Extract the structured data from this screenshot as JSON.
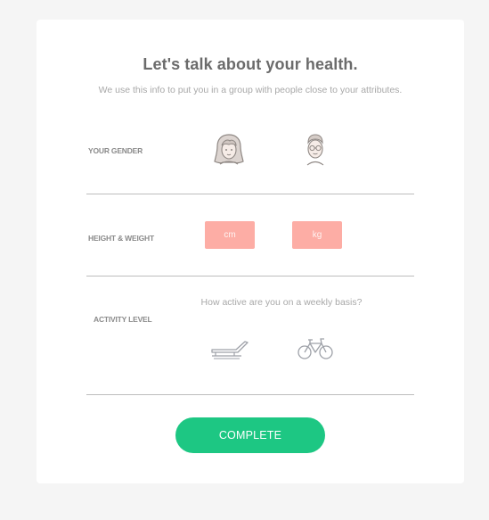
{
  "header": {
    "title": "Let's talk about your health.",
    "subtitle": "We use this info to put you in a group with people close to your attributes."
  },
  "gender": {
    "label": "YOUR GENDER",
    "options": [
      {
        "icon": "female-avatar-icon"
      },
      {
        "icon": "male-avatar-icon"
      }
    ]
  },
  "body_metrics": {
    "label": "HEIGHT & WEIGHT",
    "height_placeholder": "cm",
    "weight_placeholder": "kg",
    "height_value": "",
    "weight_value": ""
  },
  "activity": {
    "label": "ACTIVITY LEVEL",
    "question": "How active are you on a weekly basis?",
    "options": [
      {
        "icon": "lounge-chair-icon"
      },
      {
        "icon": "bicycle-icon"
      }
    ]
  },
  "actions": {
    "complete_label": "COMPLETE"
  },
  "colors": {
    "background": "#f5f5f5",
    "card": "#ffffff",
    "input_fill": "#fdada5",
    "primary_button": "#1dc783",
    "title_text": "#6b6b6b",
    "muted_text": "#a8a8a8"
  }
}
